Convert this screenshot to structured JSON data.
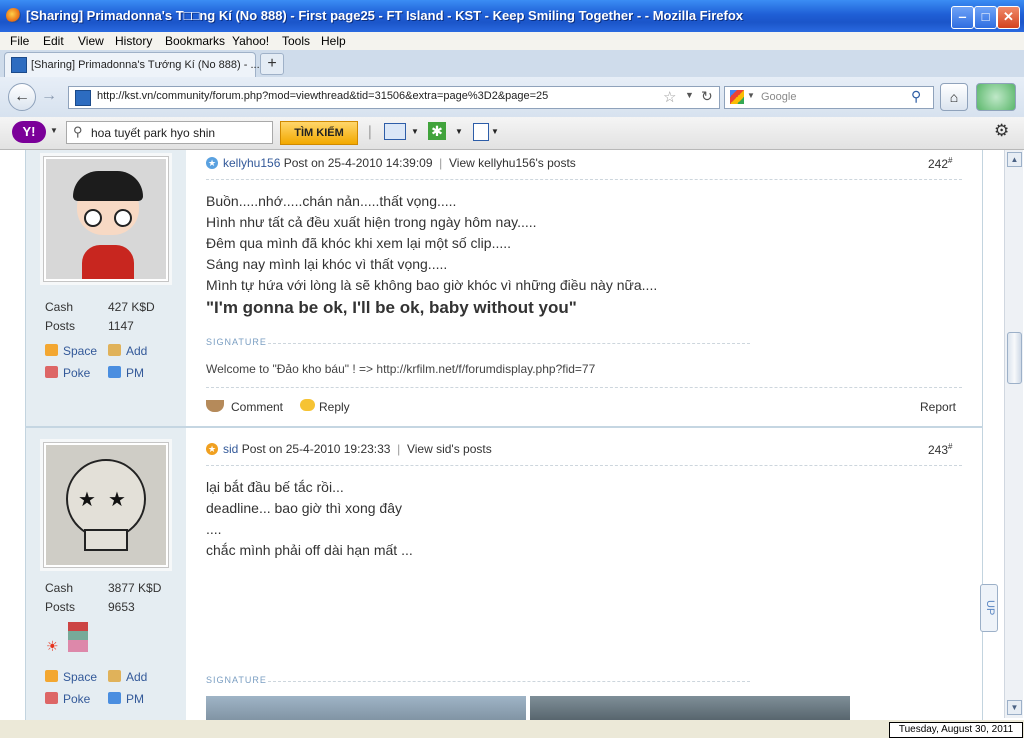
{
  "window": {
    "title": "[Sharing] Primadonna's T□□ng Kí (No 888) - First page25 - FT Island - KST - Keep Smiling Together - - Mozilla Firefox",
    "minimize": "‒",
    "maximize": "□",
    "close": "✕"
  },
  "menubar": [
    "File",
    "Edit",
    "View",
    "History",
    "Bookmarks",
    "Yahoo!",
    "Tools",
    "Help"
  ],
  "tab": {
    "label": "[Sharing] Primadonna's Tướng Kí (No 888) - ...",
    "new_tab": "+"
  },
  "navbar": {
    "url": "http://kst.vn/community/forum.php?mod=viewthread&tid=31506&extra=page%3D2&page=25",
    "search_placeholder": "Google"
  },
  "yahoo_toolbar": {
    "logo": "Y!",
    "search_value": "hoa tuyết park hyo shin",
    "search_button": "TÌM KIẾM"
  },
  "posts": [
    {
      "author": "kellyhu156",
      "posted": "Post on 25-4-2010 14:39:09",
      "view_posts": "View kellyhu156's posts",
      "number": "242",
      "number_sup": "#",
      "stats": {
        "cash_label": "Cash",
        "cash_value": "427 K$D",
        "posts_label": "Posts",
        "posts_value": "1147"
      },
      "actions": {
        "space": "Space",
        "add": "Add",
        "poke": "Poke",
        "pm": "PM"
      },
      "lines": [
        "Buồn.....nhớ.....chán nản.....thất vọng.....",
        "Hình như tất cả đều xuất hiện trong ngày hôm nay.....",
        "Đêm qua mình đã khóc khi xem lại một số clip.....",
        "Sáng nay mình lại khóc vì thất vọng.....",
        "Mình tự hứa với lòng là sẽ không bao giờ khóc vì những điều này nữa...."
      ],
      "bold_line": "\"I'm gonna be ok, I'll be ok, baby without you\"",
      "signature_tag": "SIGNATURE",
      "signature": "Welcome to \"Đảo kho báu\" ! => http://krfilm.net/f/forumdisplay.php?fid=77",
      "footer": {
        "comment": "Comment",
        "reply": "Reply",
        "report": "Report"
      }
    },
    {
      "author": "sid",
      "posted": "Post on 25-4-2010 19:23:33",
      "view_posts": "View sid's posts",
      "number": "243",
      "number_sup": "#",
      "stats": {
        "cash_label": "Cash",
        "cash_value": "3877 K$D",
        "posts_label": "Posts",
        "posts_value": "9653"
      },
      "actions": {
        "space": "Space",
        "add": "Add",
        "poke": "Poke",
        "pm": "PM"
      },
      "lines": [
        "lại bắt đầu bế tắc rồi...",
        "deadline... bao giờ thì xong đây",
        "....",
        "chắc mình phải off dài hạn mất ..."
      ],
      "signature_tag": "SIGNATURE"
    }
  ],
  "up_button": "UP",
  "status_date": "Tuesday, August 30, 2011",
  "colors": {
    "titlebar": "#1f5fd6",
    "link": "#335999",
    "sidebar": "#e5edf2",
    "yahoo_button": "#f2a900"
  }
}
